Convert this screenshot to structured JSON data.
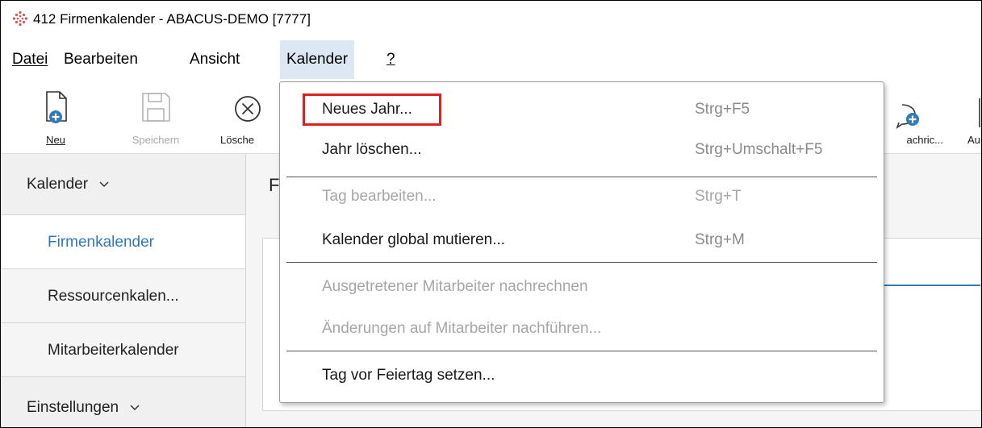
{
  "window": {
    "title": "412 Firmenkalender - ABACUS-DEMO [7777]"
  },
  "menubar": {
    "items": [
      "Datei",
      "Bearbeiten",
      "Ansicht",
      "Kalender",
      "?"
    ]
  },
  "toolbar": {
    "buttons": [
      {
        "label": "Neu",
        "icon": "new-document-icon",
        "enabled": true
      },
      {
        "label": "Speichern",
        "icon": "save-icon",
        "enabled": false
      },
      {
        "label": "Lösche",
        "icon": "delete-icon",
        "enabled": true
      },
      {
        "label": "achric...",
        "icon": "message-add-icon",
        "enabled": true
      },
      {
        "label": "Au",
        "icon": "more-icon",
        "enabled": true
      }
    ]
  },
  "sidebar": {
    "group1": "Kalender",
    "items": [
      "Firmenkalender",
      "Ressourcenkalen...",
      "Mitarbeiterkalender"
    ],
    "group2": "Einstellungen"
  },
  "main": {
    "header": "F"
  },
  "dropdown": {
    "items": [
      {
        "label": "Neues Jahr...",
        "shortcut": "Strg+F5",
        "enabled": true
      },
      {
        "label": "Jahr löschen...",
        "shortcut": "Strg+Umschalt+F5",
        "enabled": true
      },
      {
        "label": "Tag bearbeiten...",
        "shortcut": "Strg+T",
        "enabled": false
      },
      {
        "label": "Kalender global mutieren...",
        "shortcut": "Strg+M",
        "enabled": true
      },
      {
        "label": "Ausgetretener Mitarbeiter nachrechnen",
        "shortcut": "",
        "enabled": false
      },
      {
        "label": "Änderungen auf Mitarbeiter nachführen...",
        "shortcut": "",
        "enabled": false
      },
      {
        "label": "Tag vor Feiertag setzen...",
        "shortcut": "",
        "enabled": true
      }
    ]
  },
  "colors": {
    "accent_blue": "#2f7ab9",
    "highlight_red": "#e02020",
    "menu_active": "#dce8f3"
  }
}
